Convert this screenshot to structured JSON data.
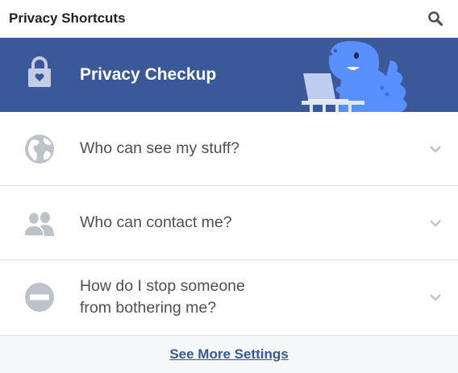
{
  "header": {
    "title": "Privacy Shortcuts",
    "search_icon": "search-icon"
  },
  "checkup": {
    "label": "Privacy Checkup",
    "icon": "lock-icon",
    "background": "#3b5998"
  },
  "items": [
    {
      "label": "Who can see my stuff?",
      "icon": "globe-icon"
    },
    {
      "label": "Who can contact me?",
      "icon": "people-icon"
    },
    {
      "line1": "How do I stop someone",
      "line2": "from bothering me?",
      "icon": "block-icon"
    }
  ],
  "footer": {
    "link": "See More Settings"
  },
  "colors": {
    "brand": "#3b5998",
    "link": "#365899",
    "icon_gray": "#bec2c9",
    "mascot": "#5890ff"
  }
}
